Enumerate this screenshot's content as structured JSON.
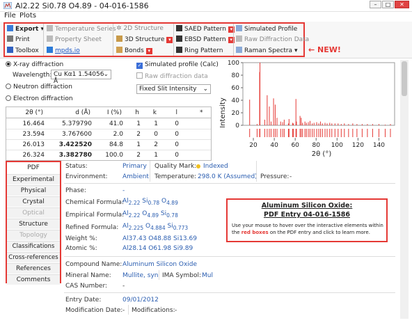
{
  "window": {
    "title": "Al2.22 Si0.78 O4.89 - 04-016-1586",
    "min": "–",
    "max": "□",
    "close": "✕"
  },
  "menu": [
    "File",
    "Plots"
  ],
  "ribbon": {
    "export": "Export",
    "print": "Print",
    "toolbox": "Toolbox",
    "temp_series": "Temperature Series",
    "property_sheet": "Property Sheet",
    "mpds": "mpds.io",
    "structure_2d": "2D Structure",
    "structure_3d": "3D Structure",
    "bonds": "Bonds",
    "saed": "SAED Pattern",
    "ebsd": "EBSD Pattern",
    "ring": "Ring Pattern",
    "sim_profile": "Simulated Profile",
    "raw_data": "Raw Diffraction Data",
    "raman": "Raman Spectra",
    "new_label": "NEW!",
    "accent": "#e53935"
  },
  "diffraction": {
    "xray": "X-ray diffraction",
    "wavelength_label": "Wavelength:",
    "wavelength_value": "Cu Kα1 1.54056 Å",
    "neutron": "Neutron diffraction",
    "electron": "Electron diffraction",
    "sim_profile": "Simulated profile (Calc)",
    "raw_data": "Raw diffraction data",
    "slit": "Fixed Slit Intensity"
  },
  "table": {
    "headers": [
      "2θ (°)",
      "d (Å)",
      "I (%)",
      "h",
      "k",
      "l",
      "*"
    ],
    "rows": [
      [
        "16.464",
        "5.379790",
        "41.0",
        "1",
        "1",
        "0",
        ""
      ],
      [
        "23.594",
        "3.767600",
        "2.0",
        "2",
        "0",
        "0",
        ""
      ],
      [
        "26.013",
        "3.422520",
        "84.8",
        "1",
        "2",
        "0",
        ""
      ],
      [
        "26.324",
        "3.382780",
        "100.0",
        "2",
        "1",
        "0",
        ""
      ]
    ]
  },
  "chart_data": {
    "type": "bar",
    "xlabel": "2θ (°)",
    "ylabel": "Intensity",
    "xlim": [
      10,
      155
    ],
    "ylim": [
      0,
      100
    ],
    "xticks": [
      20,
      40,
      60,
      80,
      100,
      120,
      140
    ],
    "yticks": [
      0,
      20,
      40,
      60,
      80,
      100
    ],
    "series": [
      {
        "x": [
          16.464,
          23.594,
          26.013,
          26.324,
          30.9,
          33.2,
          35.3,
          37.0,
          39.3,
          40.9,
          42.6,
          46.1,
          48.0,
          49.5,
          53.5,
          54.1,
          57.5,
          58.3,
          60.7,
          61.2,
          64.6,
          65.7,
          67.0,
          69.3,
          70.7,
          72.6,
          74.2,
          76.2,
          78.0,
          80.5,
          82.5,
          84.2,
          86.0,
          88.5,
          90.5,
          93.0,
          95.0,
          98.0,
          101.0,
          104.0,
          107.0,
          111.0,
          115.0,
          119.0,
          124.0,
          129.0,
          134.0,
          140.0,
          146.0,
          151.0
        ],
        "values": [
          41,
          2,
          85,
          100,
          9,
          48,
          30,
          6,
          43,
          33,
          12,
          6,
          5,
          9,
          3,
          10,
          4,
          3,
          42,
          6,
          15,
          12,
          4,
          6,
          4,
          5,
          7,
          3,
          4,
          5,
          3,
          6,
          3,
          4,
          3,
          4,
          3,
          3,
          3,
          2,
          3,
          2,
          3,
          2,
          2,
          2,
          2,
          2,
          1,
          2
        ]
      }
    ]
  },
  "sidetabs": [
    "PDF",
    "Experimental",
    "Physical",
    "Crystal",
    "Optical",
    "Structure",
    "Topology",
    "Classifications",
    "Cross-references",
    "References",
    "Comments"
  ],
  "pdf": {
    "status_label": "Status:",
    "status": "Primary",
    "quality_label": "Quality Mark:",
    "quality": "Indexed",
    "env_label": "Environment:",
    "env": "Ambient",
    "temp_label": "Temperature:",
    "temp": "298.0 K (Assumed)",
    "pressure_label": "Pressure:",
    "pressure": "-",
    "phase_label": "Phase:",
    "phase": "-",
    "chem_label": "Chemical Formula:",
    "emp_label": "Empirical Formula:",
    "ref_label": "Refined Formula:",
    "chem_formula": {
      "a": "Al",
      "a_sub": "2.22",
      "b": "Si",
      "b_sub": "0.78",
      "c": "O",
      "c_sub": "4.89"
    },
    "emp_formula": {
      "a": "Al",
      "a_sub": "2.22",
      "b": "O",
      "b_sub": "4.89",
      "c": "Si",
      "c_sub": "0.78"
    },
    "ref_formula": {
      "a": "Al",
      "a_sub": "2.225",
      "b": "O",
      "b_sub": "4.884",
      "c": "Si",
      "c_sub": "0.773"
    },
    "weight_label": "Weight %:",
    "weight": "Al37.43 O48.88 Si13.69",
    "atomic_label": "Atomic %:",
    "atomic": "Al28.14 O61.98 Si9.89",
    "compound_label": "Compound Name:",
    "compound": "Aluminum Silicon Oxide",
    "mineral_label": "Mineral Name:",
    "mineral": "Mullite, syn",
    "ima_label": "IMA Symbol:",
    "ima": "Mul",
    "cas_label": "CAS Number:",
    "cas": "-",
    "entry_label": "Entry Date:",
    "entry": "09/01/2012",
    "mod_label": "Modification Date:",
    "mod": "-",
    "mods_label": "Modifications:",
    "mods": "-"
  },
  "infobox": {
    "title": "Aluminum Silicon Oxide:",
    "subtitle": "PDF Entry 04-016-1586",
    "text1": "Use your mouse to hover over the interactive elements within",
    "text2_pre": "the ",
    "text2_red": "red boxes",
    "text2_post": " on the PDF entry and click to learn more."
  }
}
